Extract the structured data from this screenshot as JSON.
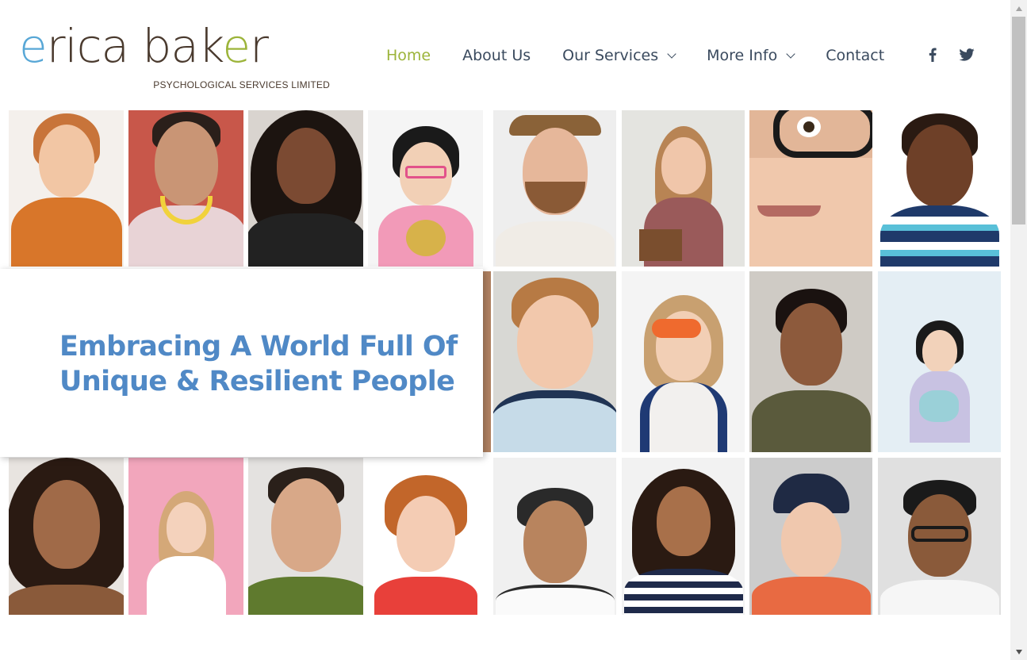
{
  "logo": {
    "name_part1": "e",
    "name_part2": "rica bak",
    "name_part3": "e",
    "name_part4": "r",
    "subtitle": "PSYCHOLOGICAL SERVICES LIMITED"
  },
  "nav": {
    "items": [
      {
        "label": "Home",
        "active": true,
        "dropdown": false
      },
      {
        "label": "About Us",
        "active": false,
        "dropdown": false
      },
      {
        "label": "Our Services",
        "active": false,
        "dropdown": true
      },
      {
        "label": "More Info",
        "active": false,
        "dropdown": true
      },
      {
        "label": "Contact",
        "active": false,
        "dropdown": false
      }
    ]
  },
  "social": {
    "facebook_icon": "facebook-icon",
    "twitter_icon": "twitter-icon"
  },
  "hero": {
    "title_line1": "Embracing A World Full Of",
    "title_line2": "Unique & Resilient People"
  },
  "colors": {
    "brand_green": "#9cb43a",
    "brand_blue": "#5089c6",
    "logo_blue": "#58a7d6",
    "logo_brown": "#4a3a2e",
    "nav_text": "#3a4a5e"
  },
  "photo_grid": {
    "icon": "portrait-photo-grid"
  }
}
